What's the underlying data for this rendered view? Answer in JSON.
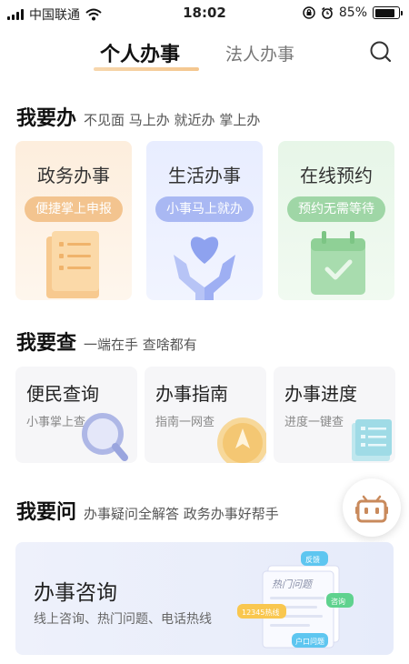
{
  "status_bar": {
    "carrier": "中国联通",
    "time": "18:02",
    "battery": "85%",
    "battery_level": 0.85
  },
  "tabs": {
    "personal": "个人办事",
    "legal": "法人办事",
    "active": "personal"
  },
  "section_do": {
    "title": "我要办",
    "subtitle": "不见面 马上办 就近办 掌上办"
  },
  "do_cards": [
    {
      "title": "政务办事",
      "pill": "便捷掌上申报"
    },
    {
      "title": "生活办事",
      "pill": "小事马上就办"
    },
    {
      "title": "在线预约",
      "pill": "预约无需等待"
    }
  ],
  "section_query": {
    "title": "我要查",
    "subtitle": "一端在手 查啥都有"
  },
  "query_cards": [
    {
      "title": "便民查询",
      "subtitle": "小事掌上查"
    },
    {
      "title": "办事指南",
      "subtitle": "指南一网查"
    },
    {
      "title": "办事进度",
      "subtitle": "进度一键查"
    }
  ],
  "section_ask": {
    "title": "我要问",
    "subtitle": "办事疑问全解答 政务办事好帮手"
  },
  "consult": {
    "title": "办事咨询",
    "subtitle": "线上咨询、热门问题、电话热线",
    "art_card": "热门问题",
    "tags": [
      "反馈",
      "咨询",
      "12345热线",
      "户口问题"
    ]
  },
  "colors": {
    "orange": "#f3c48f",
    "blue": "#a9b8f3",
    "green": "#9fd6a6",
    "accent_underline": "#f4c68e"
  },
  "icons": [
    "signal-icon",
    "wifi-icon",
    "lock-rotation-icon",
    "alarm-icon",
    "battery-icon",
    "search-icon",
    "robot-icon"
  ]
}
